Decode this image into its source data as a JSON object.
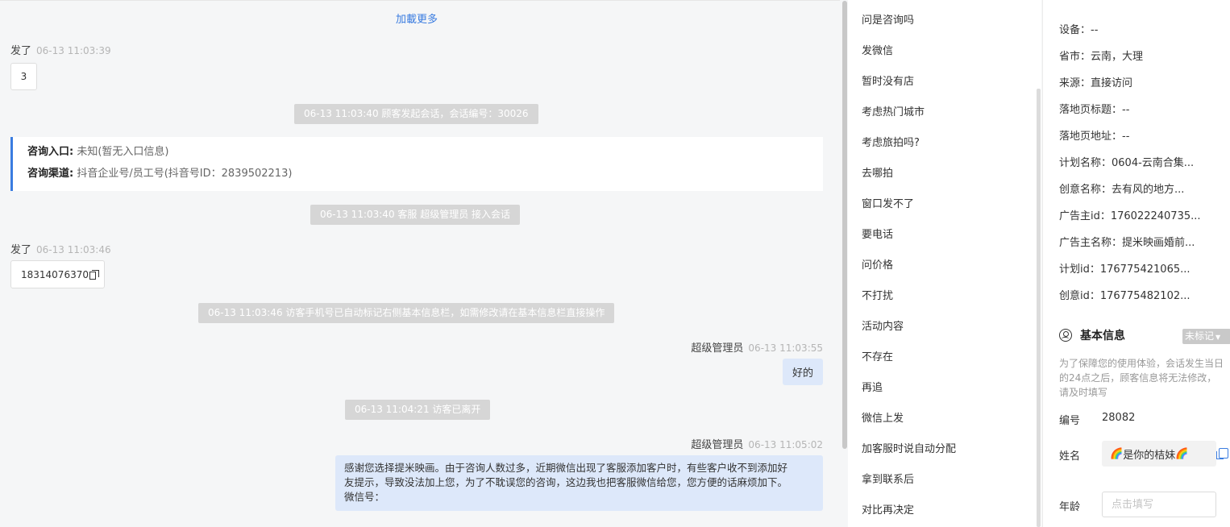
{
  "chat": {
    "load_more": "加載更多",
    "m1": {
      "sender": "发了",
      "time": "06-13 11:03:39",
      "text": "3"
    },
    "sys1": "06-13 11:03:40 顾客发起会话，会话编号：30026",
    "info_card": {
      "entry_label": "咨询入口:",
      "entry_value": "未知(暂无入口信息)",
      "channel_label": "咨询渠道:",
      "channel_value": "抖音企业号/员工号(抖音号ID：2839502213)"
    },
    "sys2": "06-13 11:03:40 客服 超级管理员 接入会话",
    "m2": {
      "sender": "发了",
      "time": "06-13 11:03:46",
      "text": "18314076370"
    },
    "sys3": "06-13 11:03:46 访客手机号已自动标记右侧基本信息栏，如需修改请在基本信息栏直接操作",
    "m3": {
      "sender": "超级管理员",
      "time": "06-13 11:03:55",
      "text": "好的"
    },
    "sys4": "06-13 11:04:21 访客已离开",
    "m4": {
      "sender": "超级管理员",
      "time": "06-13 11:05:02",
      "line1": "感谢您选择提米映画。由于咨询人数过多，近期微信出现了客服添加客户时，有些客户收不到添加好",
      "line2": "友提示，导致没法加上您，为了不耽误您的咨询，这边我也把客服微信给您，您方便的话麻烦加下。",
      "line3": "微信号："
    }
  },
  "quick_replies": [
    "问是咨询吗",
    "发微信",
    "暂时没有店",
    "考虑热门城市",
    "考虑旅拍吗?",
    "去哪拍",
    "窗口发不了",
    "要电话",
    "问价格",
    "不打扰",
    "活动内容",
    "不存在",
    "再追",
    "微信上发",
    "加客服时说自动分配",
    "拿到联系后",
    "对比再决定"
  ],
  "source_info": {
    "device": "设备：--",
    "province": "省市：云南，大理",
    "source": "来源：直接访问",
    "landing_title": "落地页标题：--",
    "landing_url": "落地页地址：--",
    "plan_name": "计划名称：0604-云南合集...",
    "creative_name": "创意名称：去有风的地方...",
    "advertiser_id": "广告主id：176022240735...",
    "advertiser_name": "广告主名称：提米映画婚前...",
    "plan_id": "计划id：176775421065...",
    "creative_id": "创意id：176775482102..."
  },
  "basic_info": {
    "title": "基本信息",
    "tag": "未标记",
    "note": "为了保障您的使用体验，会话发生当日的24点之后，顾客信息将无法修改，请及时填写",
    "id_label": "编号",
    "id_value": "28082",
    "name_label": "姓名",
    "name_value": "是你的桔妹",
    "age_label": "年龄",
    "age_placeholder": "点击填写"
  },
  "colors": {
    "accent": "#3a7ce0",
    "agent_bubble": "#dde8fa",
    "system_bg": "#d6d6d6"
  }
}
